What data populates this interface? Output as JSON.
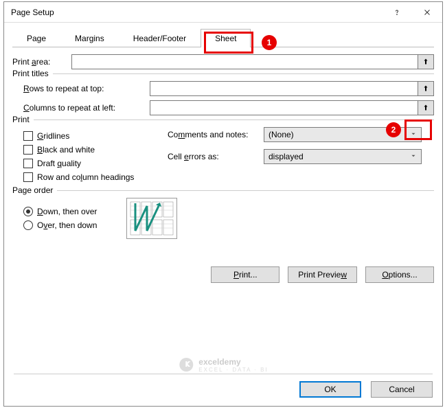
{
  "titlebar": {
    "title": "Page Setup"
  },
  "tabs": {
    "page": "Page",
    "margins": "Margins",
    "header_footer": "Header/Footer",
    "sheet": "Sheet"
  },
  "sheet": {
    "print_area_label": "Print area:",
    "print_titles_legend": "Print titles",
    "rows_repeat_label": "Rows to repeat at top:",
    "cols_repeat_label": "Columns to repeat at left:",
    "print_legend": "Print",
    "gridlines": "Gridlines",
    "black_white": "Black and white",
    "draft": "Draft quality",
    "row_col_headings": "Row and column headings",
    "comments_label": "Comments and notes:",
    "comments_value": "(None)",
    "cell_errors_label": "Cell errors as:",
    "cell_errors_value": "displayed",
    "page_order_legend": "Page order",
    "down_then_over": "Down, then over",
    "over_then_down": "Over, then down"
  },
  "buttons": {
    "print": "Print...",
    "preview": "Print Preview",
    "options": "Options...",
    "ok": "OK",
    "cancel": "Cancel"
  },
  "annotations": {
    "one": "1",
    "two": "2"
  },
  "watermark": {
    "brand": "exceldemy",
    "tagline": "EXCEL · DATA · BI"
  }
}
